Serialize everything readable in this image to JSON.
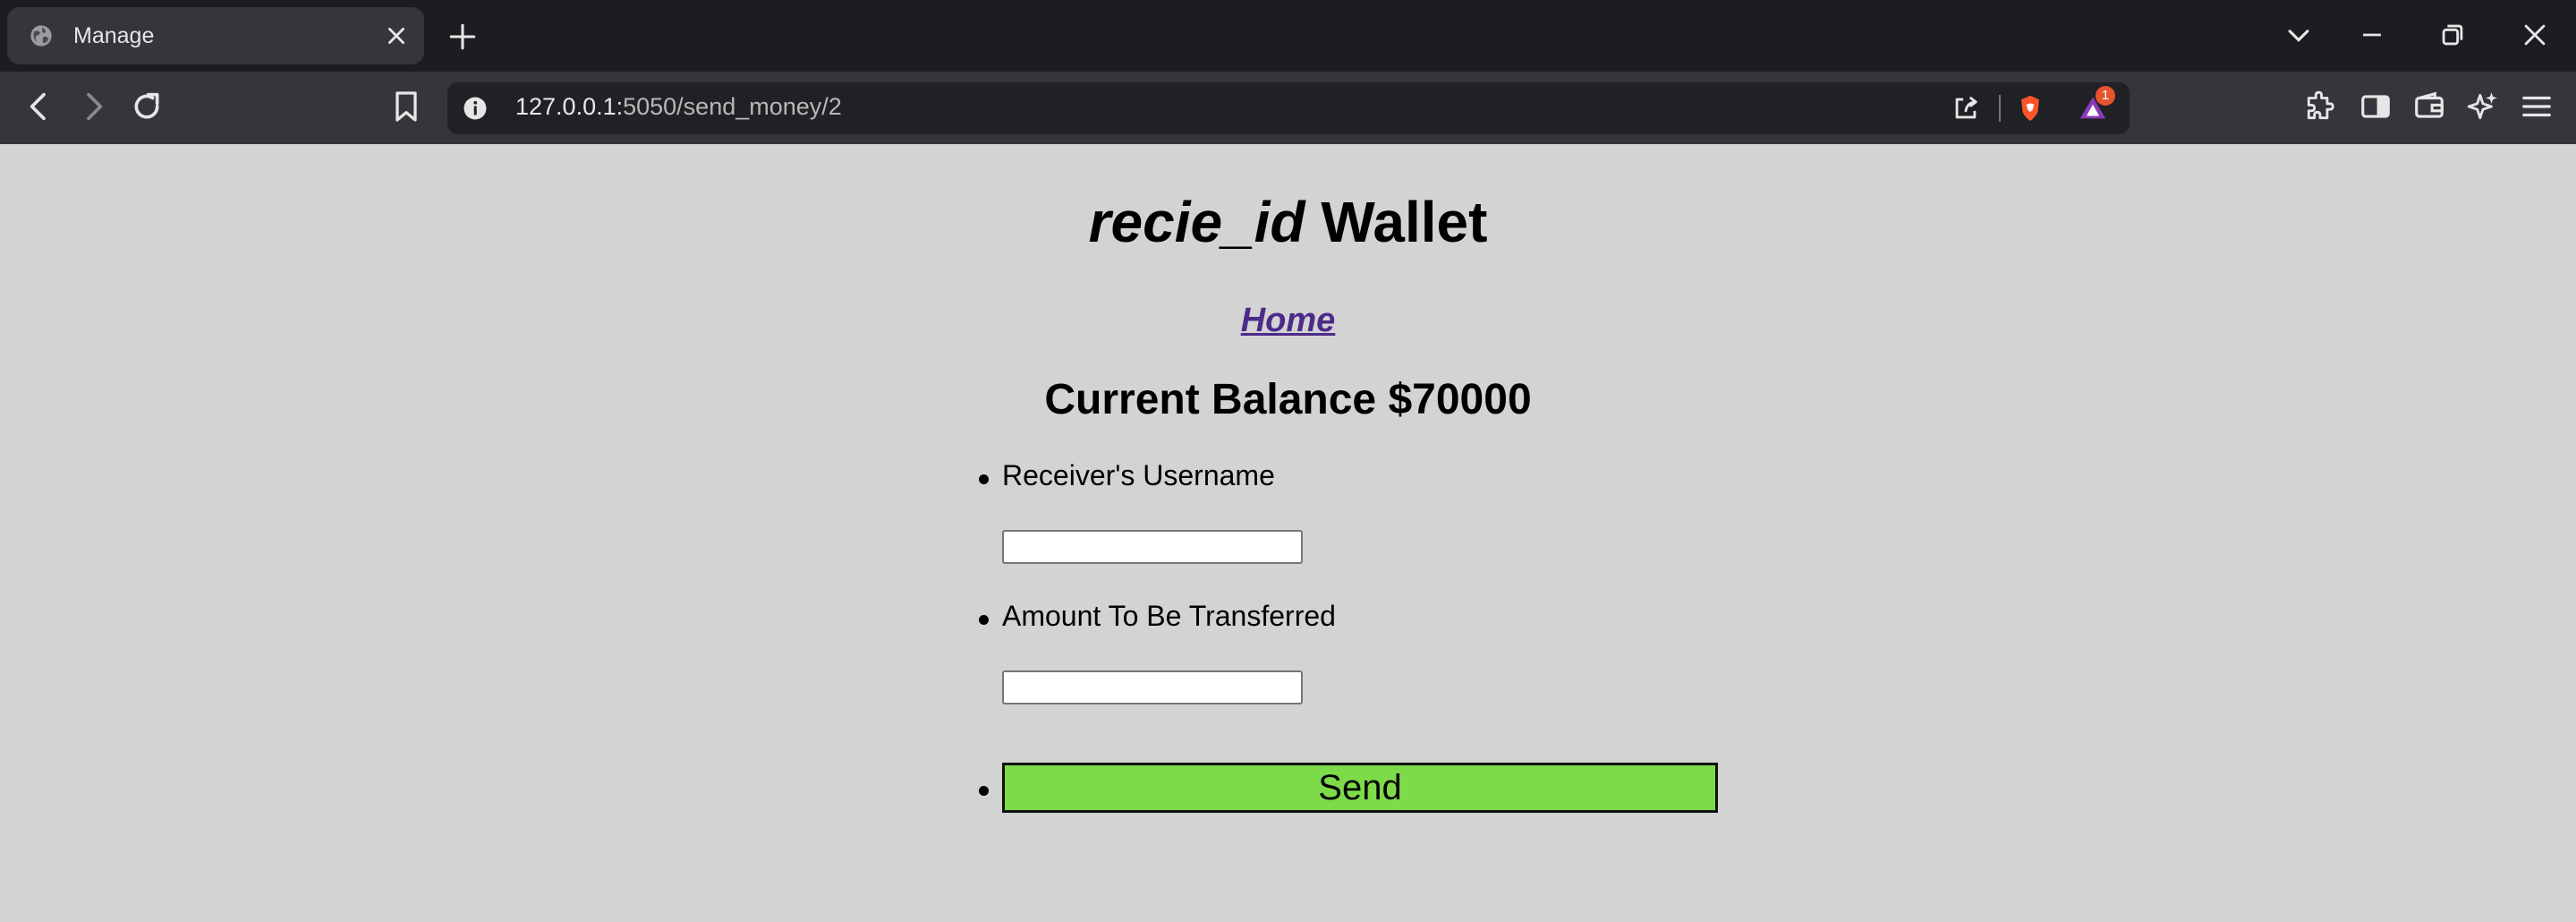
{
  "browser": {
    "tab_title": "Manage",
    "url_host": "127.0.0.1:",
    "url_path": "5050/send_money/2",
    "extension_badge": "1",
    "colors": {
      "chrome": "#202124",
      "toolbar": "#35353b",
      "badge": "#e5542c"
    }
  },
  "page": {
    "title_italic": "recie_id",
    "title_rest": " Wallet",
    "home_link": "Home",
    "balance": "Current Balance $70000",
    "form": {
      "receiver_label": "Receiver's Username",
      "receiver_value": "",
      "amount_label": "Amount To Be Transferred",
      "amount_value": "",
      "send_label": "Send"
    },
    "colors": {
      "background": "#d3d3d3",
      "link": "#4d2a8a",
      "send_button": "#7ddb4a"
    }
  }
}
